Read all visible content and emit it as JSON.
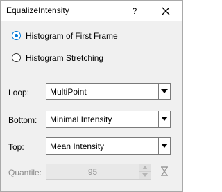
{
  "window": {
    "title": "EqualizeIntensity",
    "help_label": "?",
    "close_icon": "close-icon"
  },
  "mode": {
    "options": [
      {
        "label": "Histogram of First Frame",
        "checked": true
      },
      {
        "label": "Histogram Stretching",
        "checked": false
      }
    ]
  },
  "fields": {
    "loop": {
      "label": "Loop:",
      "value": "MultiPoint"
    },
    "bottom": {
      "label": "Bottom:",
      "value": "Minimal Intensity"
    },
    "top": {
      "label": "Top:",
      "value": "Mean Intensity"
    },
    "quantile": {
      "label": "Quantile:",
      "value": "95",
      "enabled": false,
      "reset_icon": "hourglass-reset-icon"
    }
  },
  "colors": {
    "accent": "#0078d7",
    "disabled_text": "#8a8a8a"
  }
}
